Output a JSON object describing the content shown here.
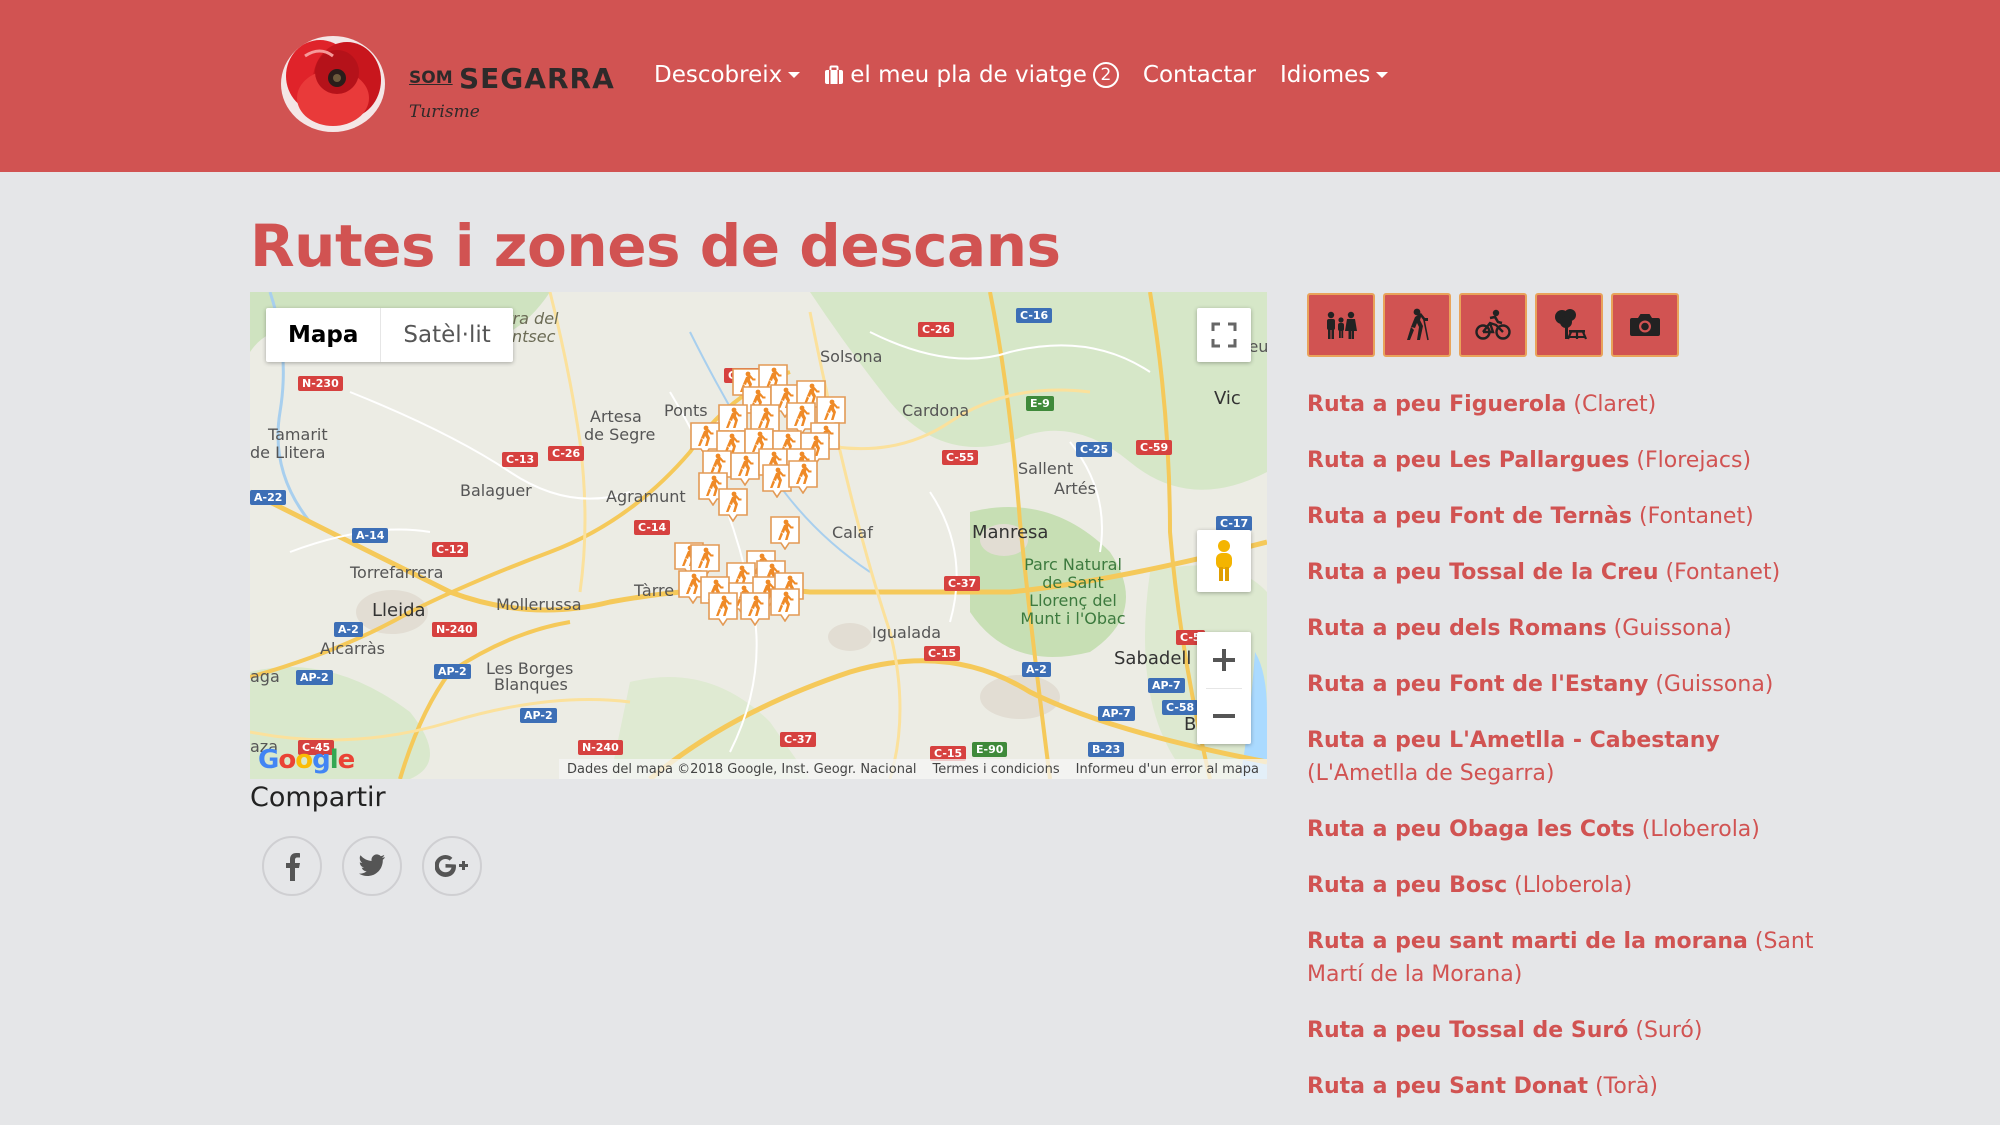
{
  "header": {
    "brand_prefix": "SOM",
    "brand_name": "SEGARRA",
    "brand_sub": "Turisme",
    "nav": [
      {
        "label": "Descobreix",
        "dropdown": true
      },
      {
        "label": "el meu pla de viatge",
        "badge": "2",
        "icon": "suitcase-icon"
      },
      {
        "label": "Contactar"
      },
      {
        "label": "Idiomes",
        "dropdown": true
      }
    ]
  },
  "page": {
    "title": "Rutes i zones de descans"
  },
  "map": {
    "type_buttons": [
      "Mapa",
      "Satèl·lit"
    ],
    "active_type": "Mapa",
    "footer": [
      "Dades del mapa ©2018 Google, Inst. Geogr. Nacional",
      "Termes i condicions",
      "Informeu d'un error al mapa"
    ],
    "logo_text": "Google",
    "places": {
      "solsona": "Solsona",
      "cardona": "Cardona",
      "vic": "Vic",
      "ponts": "Ponts",
      "artesa": "Artesa",
      "artesa2": "de Segre",
      "tamarit": "Tamarit",
      "tamarit2": "de Llitera",
      "balaguer": "Balaguer",
      "agramunt": "Agramunt",
      "sallent": "Sallent",
      "artes": "Artés",
      "calaf": "Calaf",
      "manresa": "Manresa",
      "torrefarrera": "Torrefarrera",
      "lleida": "Lleida",
      "mollerussa": "Mollerussa",
      "tarrega": "Tàrre",
      "alcarras": "Alcarràs",
      "igualada": "Igualada",
      "park": "Parc Natural de Sant Llorenç del Munt i l'Obac",
      "sabadell": "Sabadell",
      "borges": "Les Borges",
      "borges2": "Blanques",
      "aga": "aga",
      "aza": "aza",
      "montsec": "rra del",
      "montsec2": "ntsec",
      "ba": "Ba",
      "leu": "leu"
    },
    "roads": {
      "c26a": "C-26",
      "c16": "C-16",
      "n230": "N-230",
      "c14a": "C-14",
      "e9": "E-9",
      "c13": "C-13",
      "c26b": "C-26",
      "c55": "C-55",
      "c25": "C-25",
      "c59": "C-59",
      "a22": "A-22",
      "a14": "A-14",
      "c14b": "C-14",
      "c17": "C-17",
      "c12": "C-12",
      "c37a": "C-37",
      "a2a": "A-2",
      "n240a": "N-240",
      "c15a": "C-15",
      "c5": "C-5",
      "a2b": "A-2",
      "ap2a": "AP-2",
      "ap2b": "AP-2",
      "ap7a": "AP-7",
      "ap2c": "AP-2",
      "ap7b": "AP-7",
      "c58": "C-58",
      "n240b": "N-240",
      "c37b": "C-37",
      "c15b": "C-15",
      "e90": "E-90",
      "b23": "B-23",
      "c45": "C-45"
    }
  },
  "share": {
    "title": "Compartir",
    "buttons": [
      "facebook-icon",
      "twitter-icon",
      "google-plus-icon"
    ]
  },
  "filters": [
    "family-icon",
    "hiking-icon",
    "cycling-icon",
    "picnic-icon",
    "camera-icon"
  ],
  "routes": [
    {
      "name": "Ruta a peu Figuerola",
      "town": "(Claret)"
    },
    {
      "name": "Ruta a peu Les Pallargues",
      "town": "(Florejacs)"
    },
    {
      "name": "Ruta a peu Font de Ternàs",
      "town": "(Fontanet)"
    },
    {
      "name": "Ruta a peu Tossal de la Creu",
      "town": "(Fontanet)"
    },
    {
      "name": "Ruta a peu dels Romans",
      "town": "(Guissona)"
    },
    {
      "name": "Ruta a peu Font de l'Estany",
      "town": "(Guissona)"
    },
    {
      "name": "Ruta a peu L'Ametlla - Cabestany",
      "town": "(L'Ametlla de Segarra)"
    },
    {
      "name": "Ruta a peu Obaga les Cots",
      "town": "(Lloberola)"
    },
    {
      "name": "Ruta a peu Bosc",
      "town": "(Lloberola)"
    },
    {
      "name": "Ruta a peu sant marti de la morana",
      "town": "(Sant Martí de la Morana)"
    },
    {
      "name": "Ruta a peu Tossal de Suró",
      "town": "(Suró)"
    },
    {
      "name": "Ruta a peu Sant Donat",
      "town": "(Torà)"
    }
  ]
}
